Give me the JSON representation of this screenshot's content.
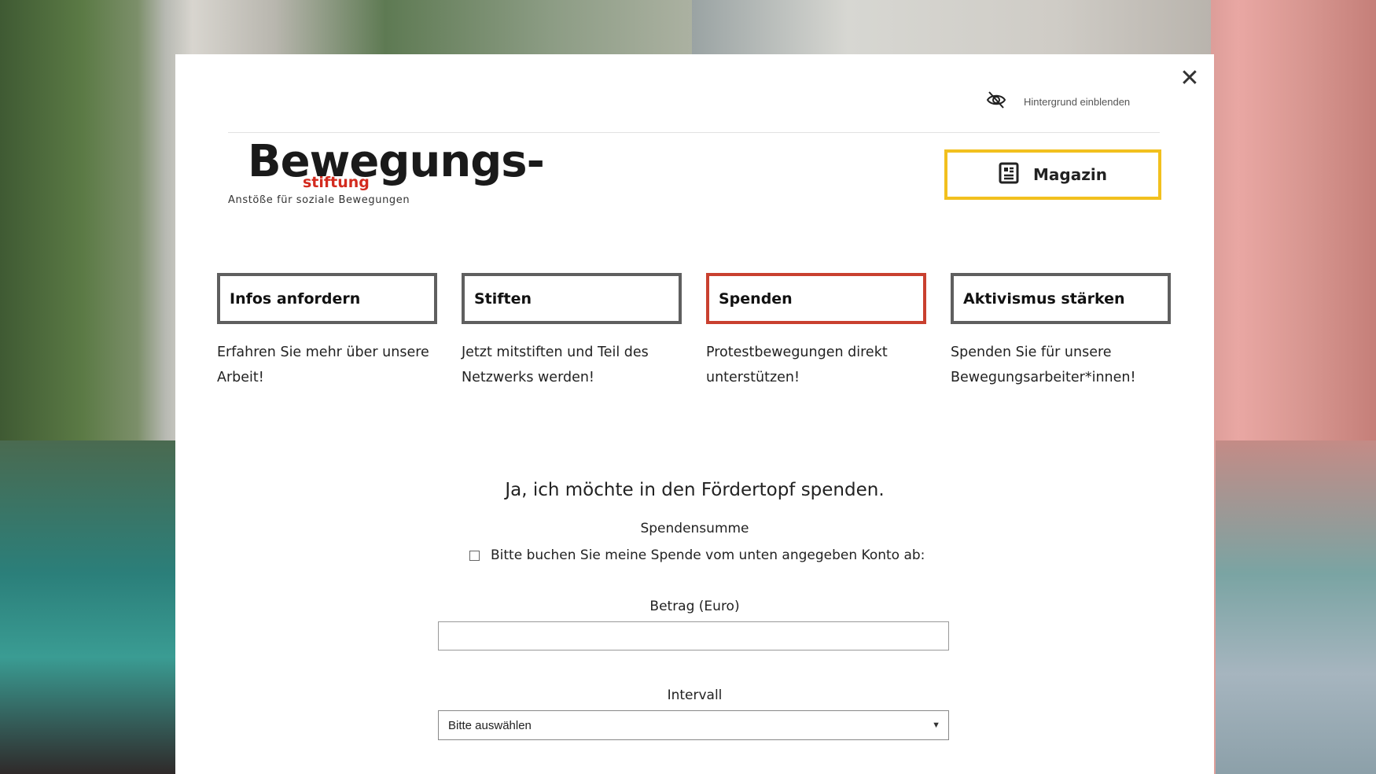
{
  "background": {
    "toggle_label": "Hintergrund einblenden",
    "toggle_icon": "eye-off-icon"
  },
  "modal": {
    "close_icon": "close-icon",
    "close_glyph": "✕"
  },
  "logo": {
    "word": "Bewegungs-",
    "sub": "stiftung",
    "tagline": "Anstöße für soziale Bewegungen",
    "accent": "#d32b1f"
  },
  "magazin": {
    "label": "Magazin",
    "icon": "newspaper-icon",
    "border_color": "#f2c01e"
  },
  "cards": [
    {
      "label": "Infos anfordern",
      "desc": "Erfahren Sie mehr über unsere Arbeit!",
      "active": false
    },
    {
      "label": "Stiften",
      "desc": "Jetzt mitstiften und Teil des Netzwerks werden!",
      "active": false
    },
    {
      "label": "Spenden",
      "desc": "Protestbewegungen direkt unterstützen!",
      "active": true
    },
    {
      "label": "Aktivismus stärken",
      "desc": "Spenden Sie für unsere Bewegungsarbeiter*innen!",
      "active": false
    }
  ],
  "form": {
    "title": "Ja, ich möchte in den Fördertopf spenden.",
    "sum_label": "Spendensumme",
    "checkbox_label": "Bitte buchen Sie meine Spende vom unten angegeben Konto ab:",
    "checkbox_checked": false,
    "amount_label": "Betrag (Euro)",
    "amount_value": "",
    "interval_label": "Intervall",
    "interval_selected": "Bitte auswählen",
    "interval_arrow": "▼"
  },
  "colors": {
    "active_border": "#c9402f",
    "default_border": "#5f5f5f"
  }
}
